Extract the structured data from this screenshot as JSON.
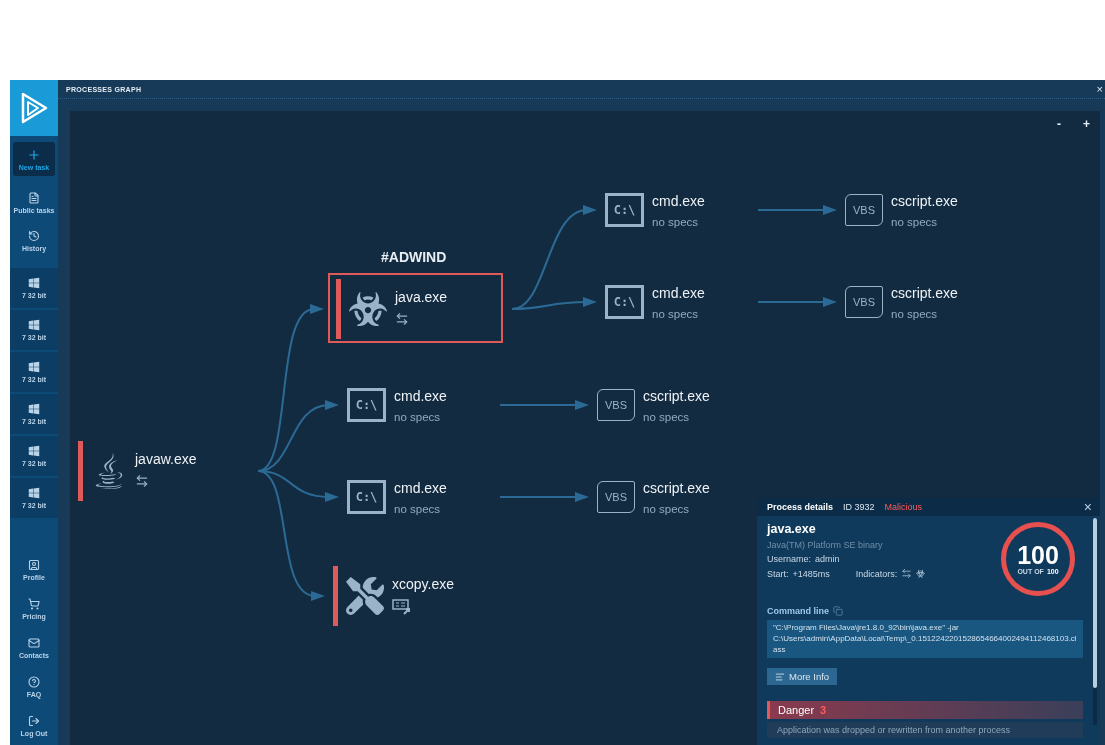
{
  "sidebar": {
    "new_task": {
      "label": "New task"
    },
    "items": [
      {
        "kind": "public-tasks",
        "label": "Public tasks"
      },
      {
        "kind": "history",
        "label": "History"
      }
    ],
    "vms": [
      {
        "kind": "windows",
        "label": "7 32 bit"
      },
      {
        "kind": "windows",
        "label": "7 32 bit"
      },
      {
        "kind": "windows",
        "label": "7 32 bit"
      },
      {
        "kind": "windows",
        "label": "7 32 bit"
      },
      {
        "kind": "windows",
        "label": "7 32 bit"
      },
      {
        "kind": "windows",
        "label": "7 32 bit"
      }
    ],
    "bottom_items": [
      {
        "kind": "profile",
        "label": "Profile"
      },
      {
        "kind": "pricing",
        "label": "Pricing"
      },
      {
        "kind": "contacts",
        "label": "Contacts"
      },
      {
        "kind": "faq",
        "label": "FAQ"
      },
      {
        "kind": "logout",
        "label": "Log Out"
      }
    ]
  },
  "panel": {
    "title": "PROCESSES GRAPH",
    "close": "×"
  },
  "zoom": [
    "-",
    "+"
  ],
  "graph": {
    "root": {
      "kind": "java",
      "name": "javaw.exe",
      "flagged": true,
      "highlighted": false,
      "indicators": [
        {
          "kind": "exchange"
        }
      ],
      "children": [
        {
          "kind": "biohazard",
          "name": "java.exe",
          "tag": "#ADWIND",
          "flagged": true,
          "highlighted": true,
          "indicators": [
            {
              "kind": "exchange"
            }
          ],
          "children": [
            {
              "kind": "cmd",
              "icon_text": "C:\\",
              "name": "cmd.exe",
              "subtitle": "no specs",
              "flagged": false,
              "highlighted": false,
              "children": [
                {
                  "kind": "cscript",
                  "icon_text": "VBS",
                  "name": "cscript.exe",
                  "subtitle": "no specs",
                  "flagged": false,
                  "highlighted": false
                }
              ]
            },
            {
              "kind": "cmd",
              "icon_text": "C:\\",
              "name": "cmd.exe",
              "subtitle": "no specs",
              "flagged": false,
              "highlighted": false,
              "children": [
                {
                  "kind": "cscript",
                  "icon_text": "VBS",
                  "name": "cscript.exe",
                  "subtitle": "no specs",
                  "flagged": false,
                  "highlighted": false
                }
              ]
            }
          ]
        },
        {
          "kind": "cmd",
          "icon_text": "C:\\",
          "name": "cmd.exe",
          "subtitle": "no specs",
          "flagged": false,
          "highlighted": false,
          "children": [
            {
              "kind": "cscript",
              "icon_text": "VBS",
              "name": "cscript.exe",
              "subtitle": "no specs",
              "flagged": false,
              "highlighted": false
            }
          ]
        },
        {
          "kind": "cmd",
          "icon_text": "C:\\",
          "name": "cmd.exe",
          "subtitle": "no specs",
          "flagged": false,
          "highlighted": false,
          "children": [
            {
              "kind": "cscript",
              "icon_text": "VBS",
              "name": "cscript.exe",
              "subtitle": "no specs",
              "flagged": false,
              "highlighted": false
            }
          ]
        },
        {
          "kind": "tools",
          "name": "xcopy.exe",
          "flagged": true,
          "highlighted": false,
          "indicators": [
            {
              "kind": "exe"
            }
          ]
        }
      ]
    }
  },
  "details": {
    "title": "Process details",
    "id": "ID 3932",
    "verdict": "Malicious",
    "close": "×",
    "name": "java.exe",
    "description": "Java(TM) Platform SE binary",
    "username_label": "Username:",
    "username": "admin",
    "start_label": "Start:",
    "start": "+1485ms",
    "indicators_label": "Indicators:",
    "indicators": [
      {
        "kind": "exchange"
      },
      {
        "kind": "biohazard"
      }
    ],
    "score": "100",
    "score_caption": "OUT OF",
    "score_max": "100",
    "command_label": "Command line",
    "command": "\"C:\\Program Files\\Java\\jre1.8.0_92\\bin\\java.exe\" -jar C:\\Users\\admin\\AppData\\Local\\Temp\\_0.1512242201528654664002494112468103.class",
    "more_info": "More Info",
    "danger": {
      "label": "Danger",
      "count": "3",
      "items": [
        "Application was dropped or rewritten from another process"
      ]
    }
  }
}
